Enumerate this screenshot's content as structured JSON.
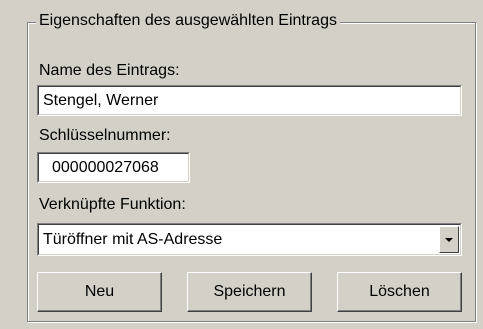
{
  "group": {
    "title": "Eigenschaften des ausgewählten Eintrags"
  },
  "name_field": {
    "label": "Name des Eintrags:",
    "value": "Stengel, Werner"
  },
  "key_field": {
    "label": "Schlüsselnummer:",
    "value": "000000027068"
  },
  "function_field": {
    "label": "Verknüpfte Funktion:",
    "selected": "Türöffner mit AS-Adresse",
    "dropdown_icon": "chevron-down-icon"
  },
  "buttons": {
    "new": "Neu",
    "save": "Speichern",
    "delete": "Löschen"
  }
}
